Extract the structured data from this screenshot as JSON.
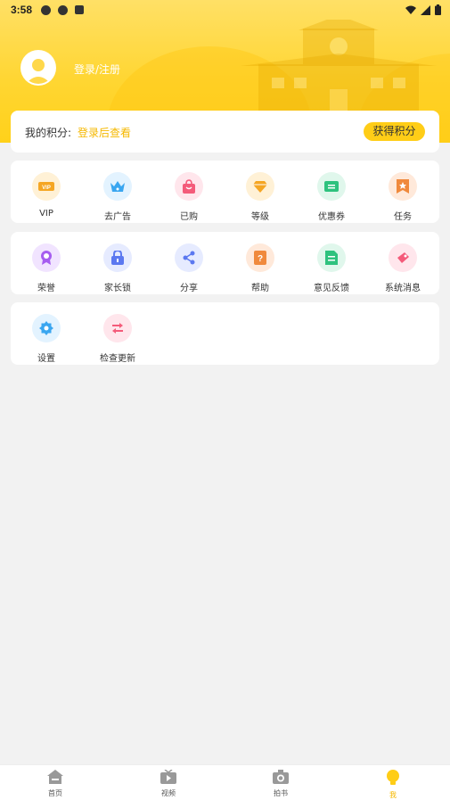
{
  "status_bar": {
    "time": "3:58"
  },
  "profile": {
    "login_label": "登录/注册"
  },
  "points": {
    "label": "我的积分:",
    "link": "登录后查看",
    "button": "获得积分"
  },
  "grid_rows": [
    [
      {
        "label": "VIP",
        "icon": "vip-icon",
        "bg": "#fff1d6",
        "color": "#f5a623"
      },
      {
        "label": "去广告",
        "icon": "crown-icon",
        "bg": "#e3f3ff",
        "color": "#3aa6f0"
      },
      {
        "label": "已购",
        "icon": "shopping-bag-icon",
        "bg": "#ffe6ec",
        "color": "#f45b7a"
      },
      {
        "label": "等级",
        "icon": "gem-icon",
        "bg": "#fff1d6",
        "color": "#f5a623"
      },
      {
        "label": "优惠券",
        "icon": "coupon-icon",
        "bg": "#e0f7ec",
        "color": "#2ec27e"
      },
      {
        "label": "任务",
        "icon": "bookmark-icon",
        "bg": "#ffe9da",
        "color": "#f0893c"
      }
    ],
    [
      {
        "label": "荣誉",
        "icon": "medal-icon",
        "bg": "#f1e4ff",
        "color": "#a65df0"
      },
      {
        "label": "家长锁",
        "icon": "lock-icon",
        "bg": "#e6ebff",
        "color": "#5b78f0"
      },
      {
        "label": "分享",
        "icon": "share-icon",
        "bg": "#e6ebff",
        "color": "#5b78f0"
      },
      {
        "label": "帮助",
        "icon": "help-book-icon",
        "bg": "#ffe9da",
        "color": "#f0893c"
      },
      {
        "label": "意见反馈",
        "icon": "feedback-icon",
        "bg": "#e0f7ec",
        "color": "#2ec27e"
      },
      {
        "label": "系统消息",
        "icon": "message-icon",
        "bg": "#ffe6ec",
        "color": "#f45b7a"
      }
    ],
    [
      {
        "label": "设置",
        "icon": "gear-icon",
        "bg": "#e3f3ff",
        "color": "#3aa6f0"
      },
      {
        "label": "检查更新",
        "icon": "update-icon",
        "bg": "#ffe6ec",
        "color": "#f45b7a"
      }
    ]
  ],
  "tabs": [
    {
      "label": "首页",
      "icon": "home-icon"
    },
    {
      "label": "视频",
      "icon": "video-icon"
    },
    {
      "label": "拍书",
      "icon": "camera-icon"
    },
    {
      "label": "我",
      "icon": "profile-bulb-icon"
    }
  ],
  "colors": {
    "accent": "#ffcd17",
    "link": "#f5b800"
  }
}
